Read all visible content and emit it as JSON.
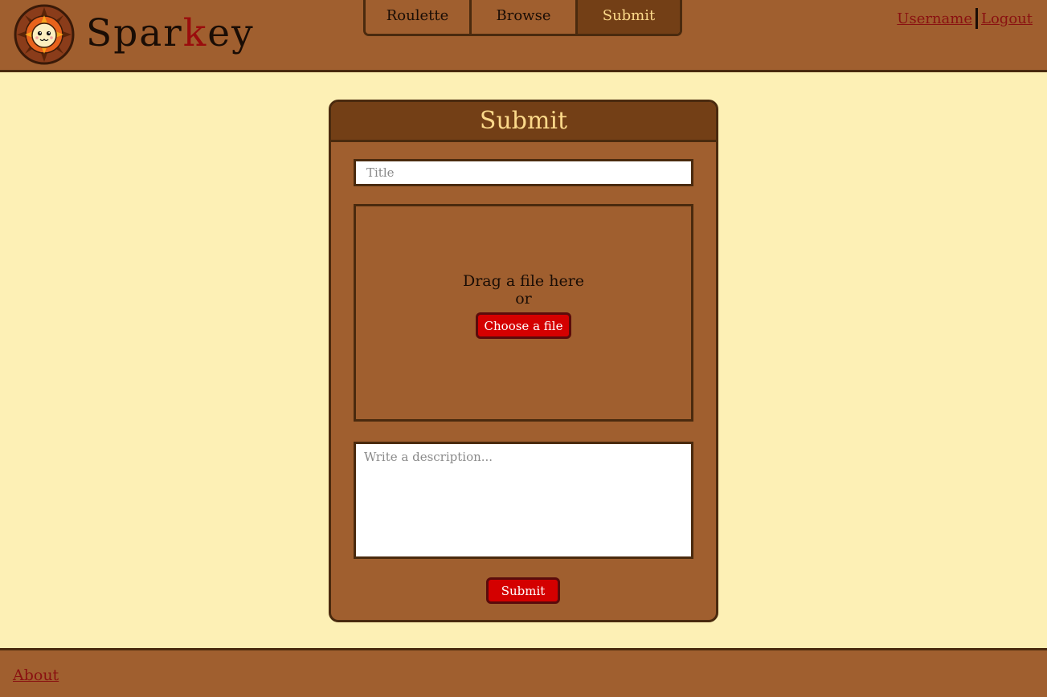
{
  "brand": {
    "prefix": "Spar",
    "accent": "k",
    "suffix": "ey"
  },
  "nav": {
    "tabs": [
      {
        "label": "Roulette",
        "active": false
      },
      {
        "label": "Browse",
        "active": false
      },
      {
        "label": "Submit",
        "active": true
      }
    ]
  },
  "user": {
    "username": "Username",
    "logout": "Logout"
  },
  "panel": {
    "title": "Submit",
    "title_placeholder": "Title",
    "drop_text": "Drag a file here",
    "or_text": "or",
    "choose_label": "Choose a file",
    "description_placeholder": "Write a description...",
    "submit_label": "Submit"
  },
  "footer": {
    "about": "About"
  },
  "colors": {
    "background": "#fdf0b5",
    "header": "#a05f2f",
    "active_tab": "#733f16",
    "border": "#4a2a0e",
    "accent_red": "#d40000",
    "link": "#8a1111"
  }
}
